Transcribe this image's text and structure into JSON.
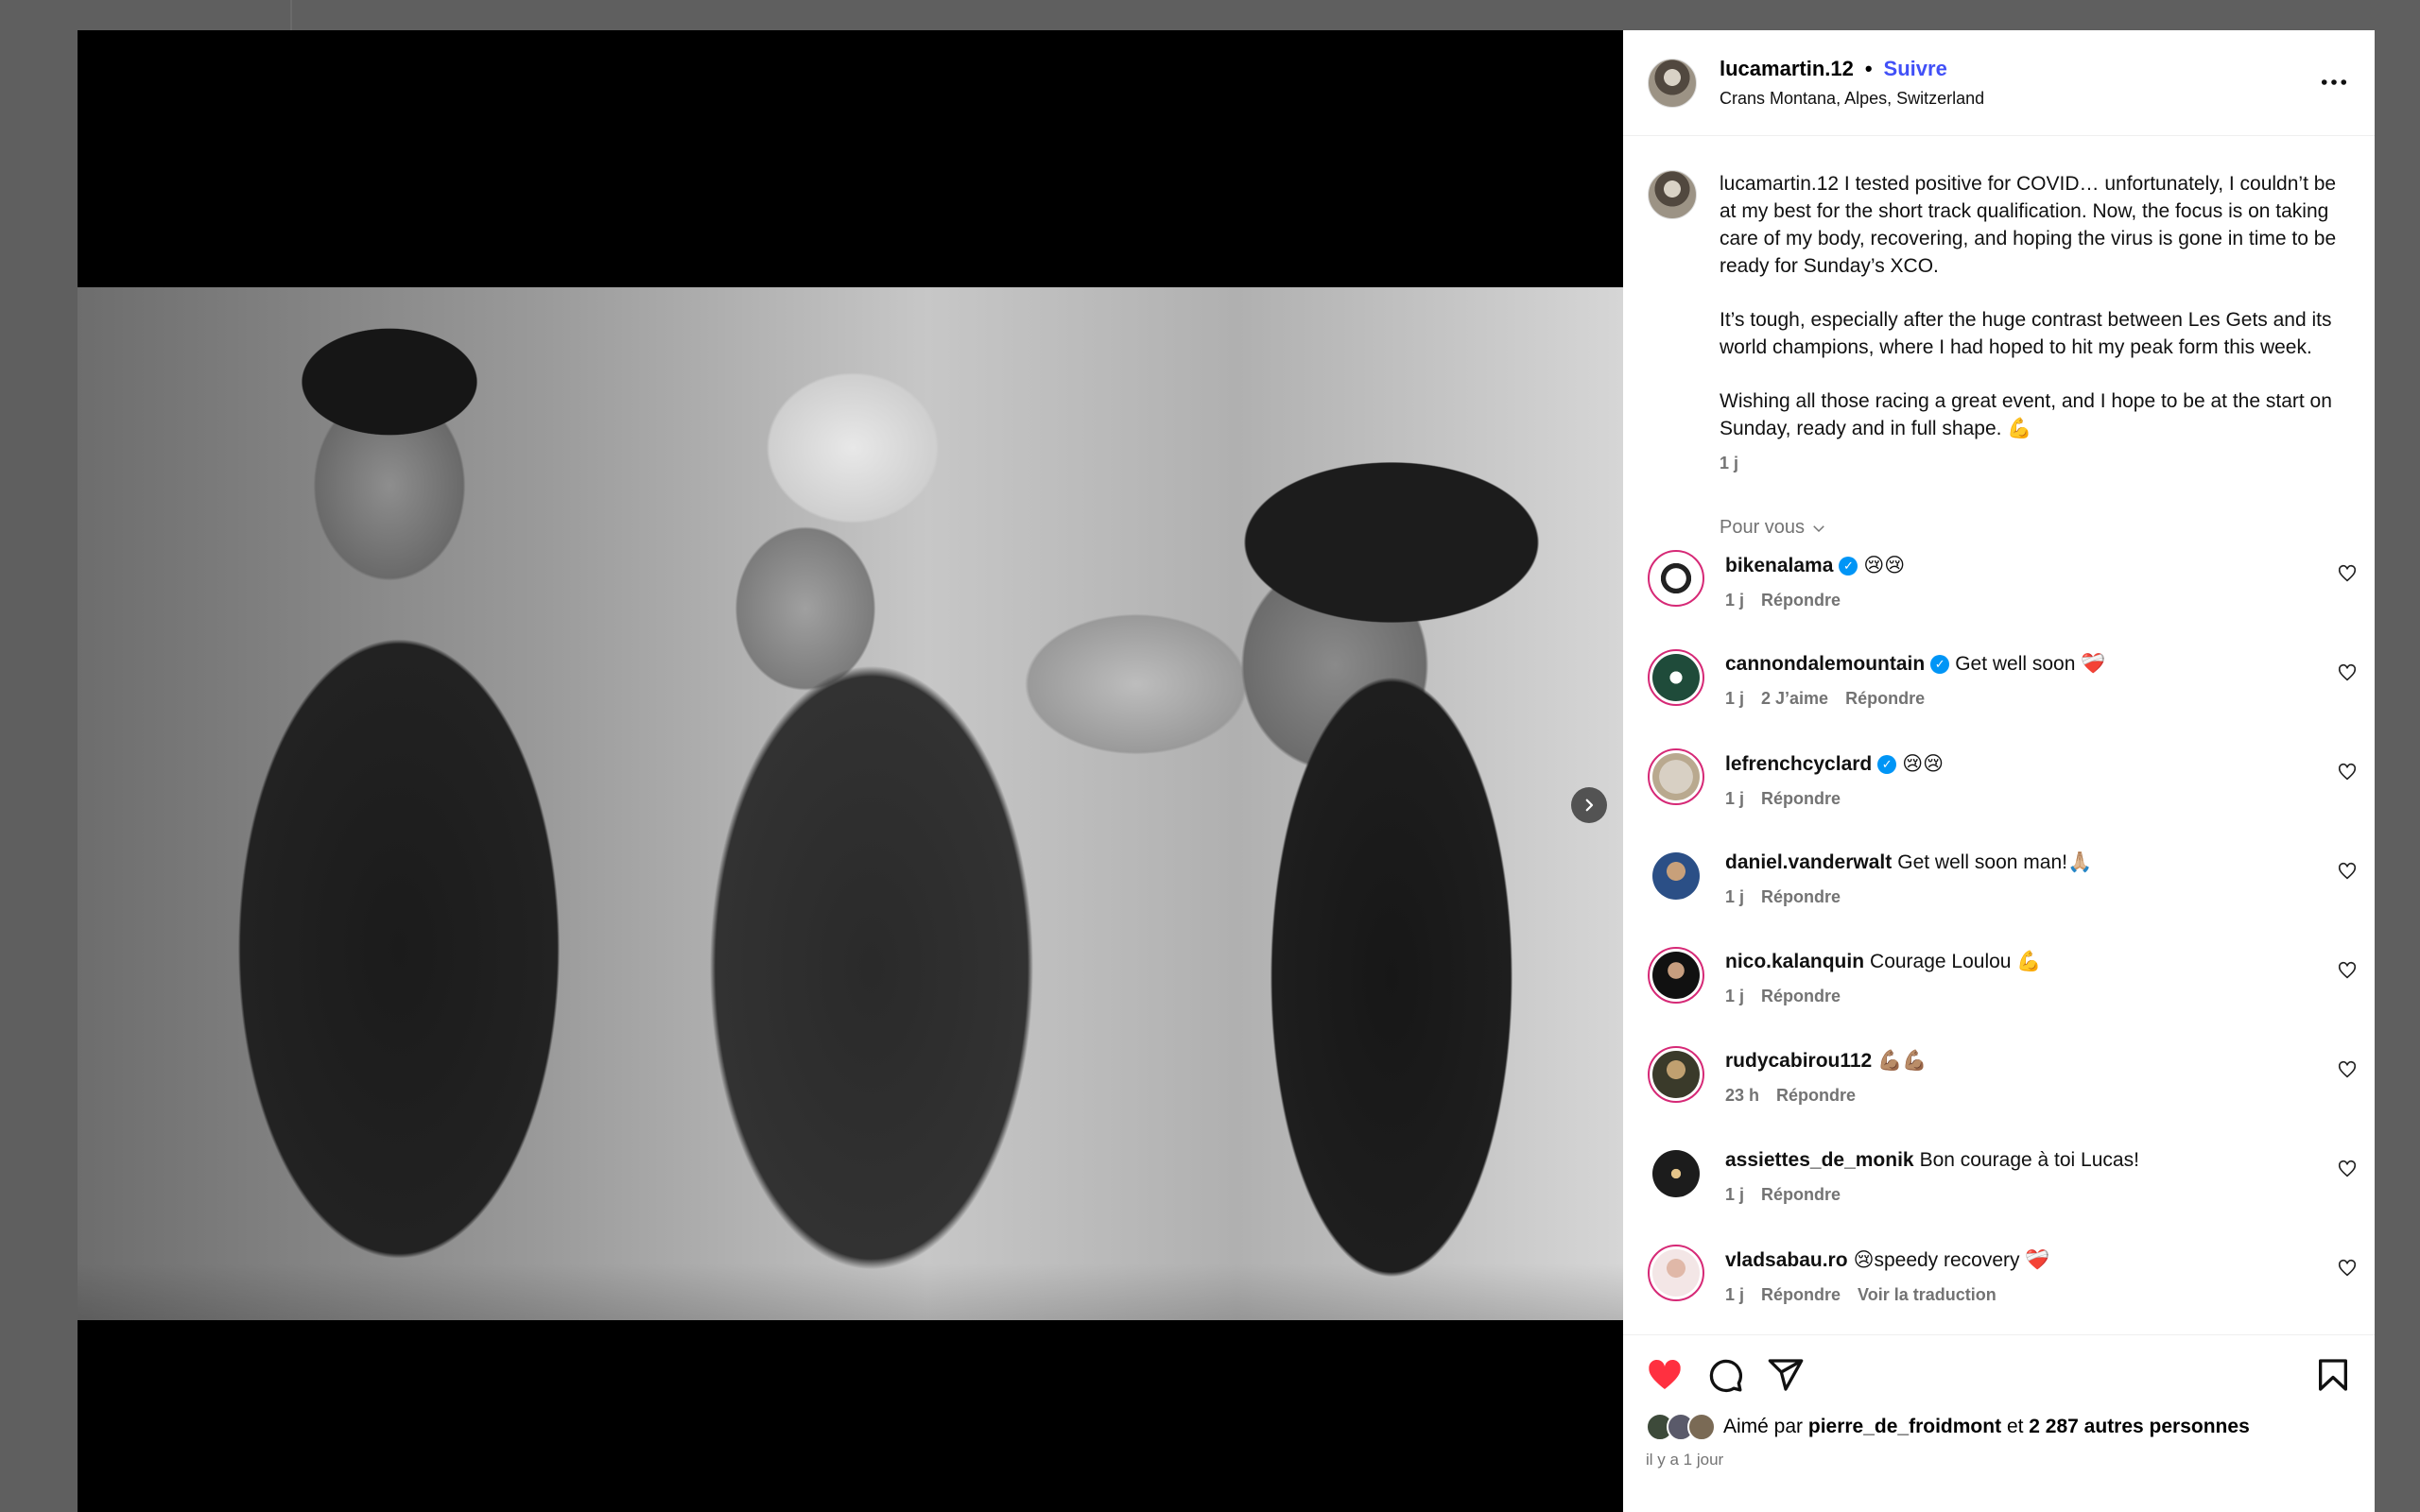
{
  "post": {
    "username": "lucamartin.12",
    "separator": "•",
    "follow_label": "Suivre",
    "location": "Crans Montana, Alpes, Switzerland",
    "more_label": "···",
    "caption_user": "lucamartin.12",
    "caption_p1": "I tested positive for COVID… unfortunately, I couldn’t be at my best for the short track qualification. Now, the focus is on taking care of my body, recovering, and hoping the virus is gone in time to be ready for Sunday’s XCO.",
    "caption_p2": "It’s tough, especially after the huge contrast between Les Gets and its world champions, where I had hoped to hit my peak form this week.",
    "caption_p3": "Wishing all those racing a great event, and I hope to be at the start on Sunday, ready and in full shape. 💪",
    "caption_time": "1 j"
  },
  "filter_label": "Pour vous",
  "comments": [
    {
      "user": "bikenalama",
      "verified": true,
      "text": "😢😢",
      "time": "1 j",
      "likes": "",
      "reply": "Répondre",
      "extra": ""
    },
    {
      "user": "cannondalemountain",
      "verified": true,
      "text": "Get well soon ❤️‍🩹",
      "time": "1 j",
      "likes": "2 J’aime",
      "reply": "Répondre",
      "extra": ""
    },
    {
      "user": "lefrenchcyclard",
      "verified": true,
      "text": "😢😢",
      "time": "1 j",
      "likes": "",
      "reply": "Répondre",
      "extra": ""
    },
    {
      "user": "daniel.vanderwalt",
      "verified": false,
      "text": "Get well soon man!🙏🏼",
      "time": "1 j",
      "likes": "",
      "reply": "Répondre",
      "extra": ""
    },
    {
      "user": "nico.kalanquin",
      "verified": false,
      "text": "Courage Loulou 💪",
      "time": "1 j",
      "likes": "",
      "reply": "Répondre",
      "extra": ""
    },
    {
      "user": "rudycabirou112",
      "verified": false,
      "text": "💪🏽💪🏽",
      "time": "23 h",
      "likes": "",
      "reply": "Répondre",
      "extra": ""
    },
    {
      "user": "assiettes_de_monik",
      "verified": false,
      "text": "Bon courage à toi Lucas!",
      "time": "1 j",
      "likes": "",
      "reply": "Répondre",
      "extra": ""
    },
    {
      "user": "vladsabau.ro",
      "verified": false,
      "text": "😢speedy recovery ❤️‍🩹",
      "time": "1 j",
      "likes": "",
      "reply": "Répondre",
      "extra": "Voir la traduction"
    }
  ],
  "likes": {
    "prefix": "Aimé par",
    "user": "pierre_de_froidmont",
    "joiner": "et",
    "count_text": "2 287 autres personnes",
    "time": "il y a 1 jour"
  },
  "colors": {
    "follow": "#4150f7",
    "liked_heart": "#ff3040",
    "verified": "#0095f6"
  },
  "icons": {
    "like": "heart-icon",
    "comment": "comment-icon",
    "share": "send-icon",
    "save": "bookmark-icon",
    "next": "chevron-right-icon"
  }
}
